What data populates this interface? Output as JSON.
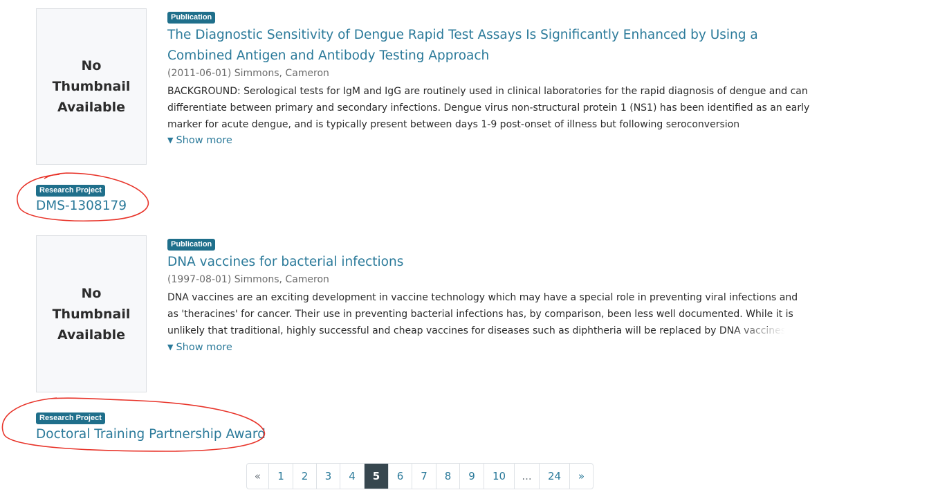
{
  "results": [
    {
      "thumbnail_text": "No Thumbnail Available",
      "badge": "Publication",
      "title": "The Diagnostic Sensitivity of Dengue Rapid Test Assays Is Significantly Enhanced by Using a Combined Antigen and Antibody Testing Approach",
      "meta": "(2011-06-01) Simmons, Cameron",
      "abstract": "BACKGROUND: Serological tests for IgM and IgG are routinely used in clinical laboratories for the rapid diagnosis of dengue and can differentiate between primary and secondary infections. Dengue virus non-structural protein 1 (NS1) has been identified as an early marker for acute dengue, and is typically present between days 1-9 post-onset of illness but following seroconversion",
      "show_more": "Show more"
    },
    {
      "badge": "Research Project",
      "title": "DMS-1308179"
    },
    {
      "thumbnail_text": "No Thumbnail Available",
      "badge": "Publication",
      "title": "DNA vaccines for bacterial infections",
      "meta": "(1997-08-01) Simmons, Cameron",
      "abstract": "DNA vaccines are an exciting development in vaccine technology which may have a special role in preventing viral infections and as 'theracines' for cancer. Their use in preventing bacterial infections has, by comparison, been less well documented. While it is unlikely that traditional, highly successful and cheap vaccines for diseases such as diphtheria will be replaced by DNA vaccines",
      "show_more": "Show more"
    },
    {
      "badge": "Research Project",
      "title": "Doctoral Training Partnership Award"
    }
  ],
  "pagination": {
    "prev": "«",
    "pages": [
      "1",
      "2",
      "3",
      "4",
      "5",
      "6",
      "7",
      "8",
      "9",
      "10",
      "...",
      "24"
    ],
    "next": "»",
    "current": "5"
  },
  "annotation_color": "#e8342a"
}
